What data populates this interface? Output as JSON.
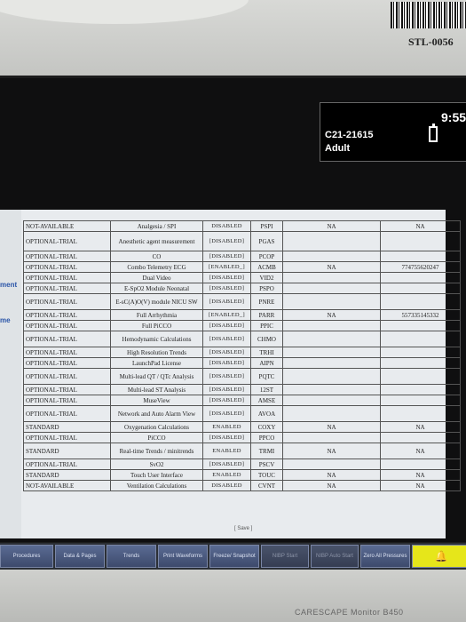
{
  "sticker": "STL-0056",
  "status": {
    "unit_id": "C21-21615",
    "patient_type": "Adult",
    "clock": "9:55"
  },
  "left_strip": [
    "ment",
    "me"
  ],
  "table": {
    "rows": [
      [
        "NOT-AVAILABLE",
        "Analgesia / SPI",
        "DISABLED",
        "PSPI",
        "NA",
        "NA"
      ],
      [
        "OPTIONAL-TRIAL",
        "Anesthetic agent measurement",
        "[DISABLED]",
        "PGAS",
        "",
        ""
      ],
      [
        "OPTIONAL-TRIAL",
        "CO",
        "[DISABLED]",
        "PCOP",
        "",
        ""
      ],
      [
        "OPTIONAL-TRIAL",
        "Combo Telemetry ECG",
        "[ENABLED_]",
        "ACMB",
        "NA",
        "774755620247"
      ],
      [
        "OPTIONAL-TRIAL",
        "Dual Video",
        "[DISABLED]",
        "VID2",
        "",
        ""
      ],
      [
        "OPTIONAL-TRIAL",
        "E-SpO2 Module Neonatal",
        "[DISABLED]",
        "PSPO",
        "",
        ""
      ],
      [
        "OPTIONAL-TRIAL",
        "E-sC(A)O(V) module NICU SW",
        "[DISABLED]",
        "PNRE",
        "",
        ""
      ],
      [
        "OPTIONAL-TRIAL",
        "Full Arrhythmia",
        "[ENABLED_]",
        "PARR",
        "NA",
        "557335145332"
      ],
      [
        "OPTIONAL-TRIAL",
        "Full PiCCO",
        "[DISABLED]",
        "PPIC",
        "",
        ""
      ],
      [
        "OPTIONAL-TRIAL",
        "Hemodynamic Calculations",
        "[DISABLED]",
        "CHMO",
        "",
        ""
      ],
      [
        "OPTIONAL-TRIAL",
        "High Resolution Trends",
        "[DISABLED]",
        "TRHI",
        "",
        ""
      ],
      [
        "OPTIONAL-TRIAL",
        "LaunchPad License",
        "[DISABLED]",
        "AIPN",
        "",
        ""
      ],
      [
        "OPTIONAL-TRIAL",
        "Multi-lead QT / QTc Analysis",
        "[DISABLED]",
        "PQTC",
        "",
        ""
      ],
      [
        "OPTIONAL-TRIAL",
        "Multi-lead ST Analysis",
        "[DISABLED]",
        "12ST",
        "",
        ""
      ],
      [
        "OPTIONAL-TRIAL",
        "MuseView",
        "[DISABLED]",
        "AMSE",
        "",
        ""
      ],
      [
        "OPTIONAL-TRIAL",
        "Network and Auto Alarm View",
        "[DISABLED]",
        "AVOA",
        "",
        ""
      ],
      [
        "STANDARD",
        "Oxygenation Calculations",
        "ENABLED",
        "COXY",
        "NA",
        "NA"
      ],
      [
        "OPTIONAL-TRIAL",
        "PiCCO",
        "[DISABLED]",
        "PPCO",
        "",
        ""
      ],
      [
        "STANDARD",
        "Real-time Trends / minitrends",
        "ENABLED",
        "TRMI",
        "NA",
        "NA"
      ],
      [
        "OPTIONAL-TRIAL",
        "SvO2",
        "[DISABLED]",
        "PSCV",
        "",
        ""
      ],
      [
        "STANDARD",
        "Touch User Interface",
        "ENABLED",
        "TOUC",
        "NA",
        "NA"
      ],
      [
        "NOT-AVAILABLE",
        "Ventilation Calculations",
        "DISABLED",
        "CVNT",
        "NA",
        "NA"
      ]
    ]
  },
  "save_label": "[ Save ]",
  "toolbar": [
    {
      "label": "Procedures",
      "state": "normal"
    },
    {
      "label": "Data & Pages",
      "state": "normal"
    },
    {
      "label": "Trends",
      "state": "normal"
    },
    {
      "label": "Print Waveforms",
      "state": "normal"
    },
    {
      "label": "Freeze/ Snapshot",
      "state": "normal"
    },
    {
      "label": "NIBP Start",
      "state": "dim"
    },
    {
      "label": "NIBP Auto Start",
      "state": "dim"
    },
    {
      "label": "Zero All Pressures",
      "state": "normal"
    },
    {
      "label": "alarm-bell-icon",
      "state": "alarm"
    }
  ],
  "brand": "CARESCAPE Monitor B450"
}
